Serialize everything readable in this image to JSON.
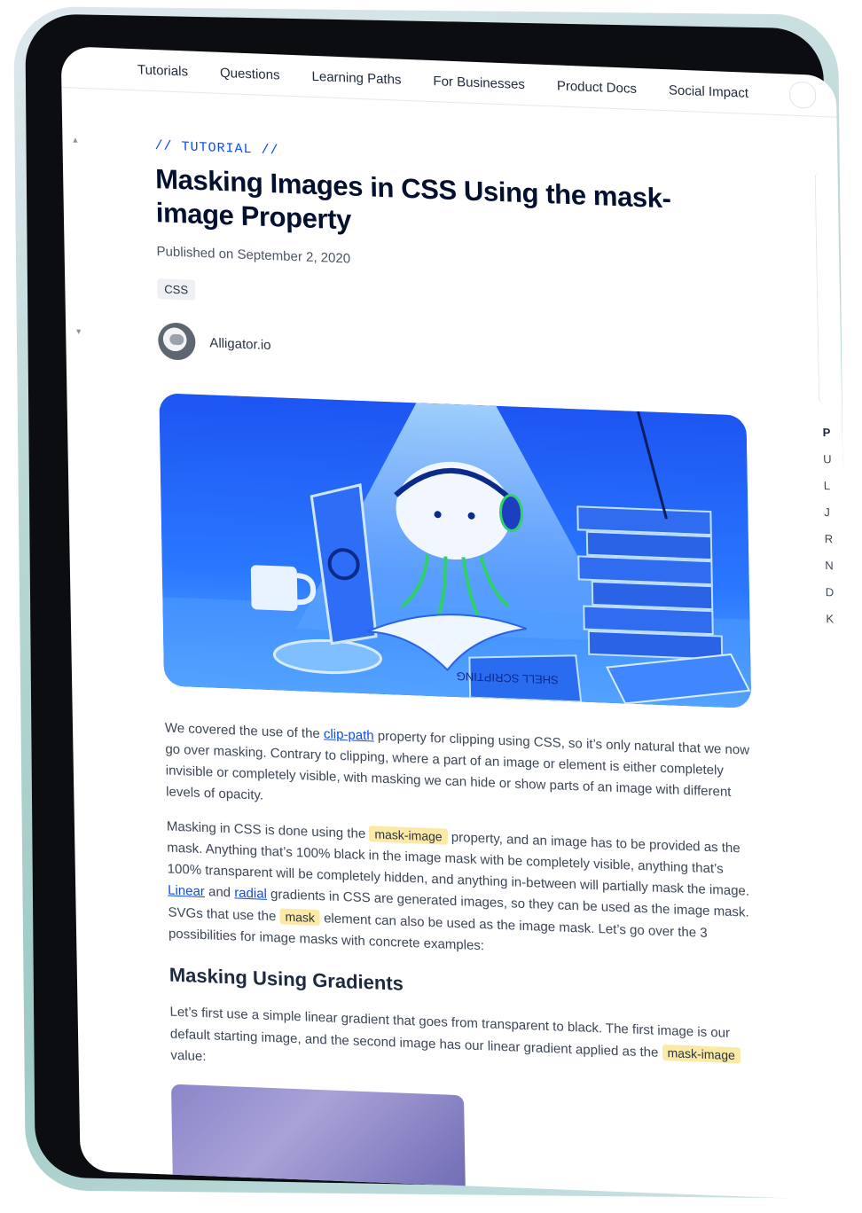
{
  "nav": {
    "items": [
      "Tutorials",
      "Questions",
      "Learning Paths",
      "For Businesses",
      "Product Docs",
      "Social Impact"
    ]
  },
  "article": {
    "eyebrow": "// TUTORIAL //",
    "title": "Masking Images in CSS Using the mask-image Property",
    "published": "Published on September 2, 2020",
    "tag": "CSS",
    "author": "Alligator.io",
    "hero_book_text": "SHELL SCRIPTING",
    "p1": {
      "a": "We covered the use of the ",
      "link": "clip-path",
      "b": " property for clipping using CSS, so it’s only natural that we now go over masking. Contrary to clipping, where a part of an image or element is either completely invisible or completely visible, with masking we can hide or show parts of an image with different levels of opacity."
    },
    "p2": {
      "a": "Masking in CSS is done using the ",
      "code1": "mask-image",
      "b": " property, and an image has to be provided as the mask. Anything that’s 100% black in the image mask with be completely visible, anything that’s 100% transparent will be completely hidden, and anything in-between will partially mask the image. ",
      "link1": "Linear",
      "c": " and ",
      "link2": "radial",
      "d": " gradients in CSS are generated images, so they can be used as the image mask. SVGs that use the ",
      "code2": "mask",
      "e": " element can also be used as the image mask. Let’s go over the 3 possibilities for image masks with concrete examples:"
    },
    "h2": "Masking Using Gradients",
    "p3": {
      "a": "Let’s first use a simple linear gradient that goes from transparent to black. The first image is our default starting image, and the second image has our linear gradient applied as the ",
      "code": "mask-image",
      "b": " value:"
    }
  },
  "toc": {
    "head": "P",
    "letters": [
      "U",
      "L",
      "J",
      "R",
      "N",
      "D",
      "K"
    ]
  },
  "colors": {
    "accent": "#0b4cf0",
    "code_bg": "#fbeaa7",
    "hero_blue": "#1f5cf6"
  }
}
